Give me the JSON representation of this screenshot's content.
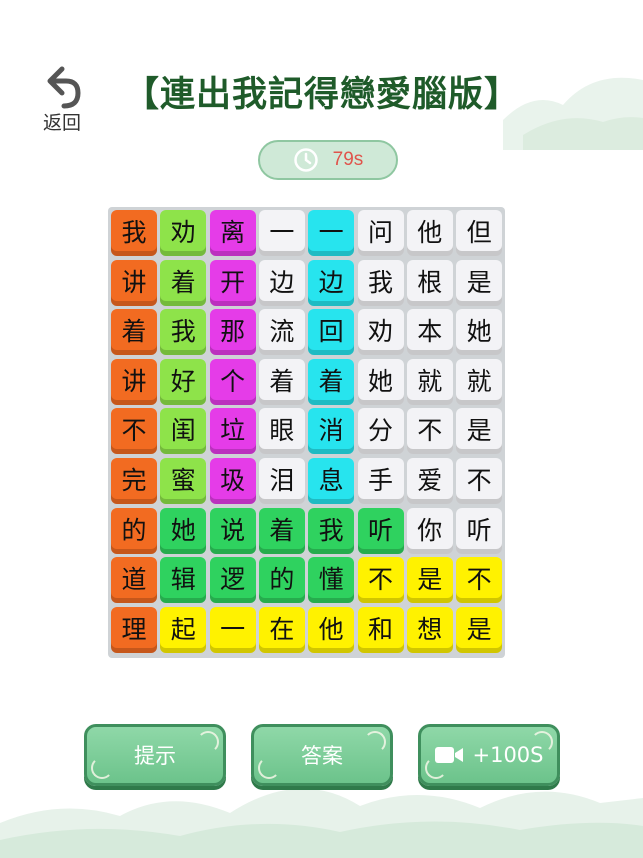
{
  "header": {
    "back_label": "返回",
    "title": "【連出我記得戀愛腦版】"
  },
  "timer": {
    "text": "79s"
  },
  "board": {
    "rows": [
      [
        [
          "我",
          "orange"
        ],
        [
          "劝",
          "lime"
        ],
        [
          "离",
          "magenta"
        ],
        [
          "一",
          "white"
        ],
        [
          "一",
          "cyan"
        ],
        [
          "问",
          "white"
        ],
        [
          "他",
          "white"
        ],
        [
          "但",
          "white"
        ]
      ],
      [
        [
          "讲",
          "orange"
        ],
        [
          "着",
          "lime"
        ],
        [
          "开",
          "magenta"
        ],
        [
          "边",
          "white"
        ],
        [
          "边",
          "cyan"
        ],
        [
          "我",
          "white"
        ],
        [
          "根",
          "white"
        ],
        [
          "是",
          "white"
        ]
      ],
      [
        [
          "着",
          "orange"
        ],
        [
          "我",
          "lime"
        ],
        [
          "那",
          "magenta"
        ],
        [
          "流",
          "white"
        ],
        [
          "回",
          "cyan"
        ],
        [
          "劝",
          "white"
        ],
        [
          "本",
          "white"
        ],
        [
          "她",
          "white"
        ]
      ],
      [
        [
          "讲",
          "orange"
        ],
        [
          "好",
          "lime"
        ],
        [
          "个",
          "magenta"
        ],
        [
          "着",
          "white"
        ],
        [
          "着",
          "cyan"
        ],
        [
          "她",
          "white"
        ],
        [
          "就",
          "white"
        ],
        [
          "就",
          "white"
        ]
      ],
      [
        [
          "不",
          "orange"
        ],
        [
          "闺",
          "lime"
        ],
        [
          "垃",
          "magenta"
        ],
        [
          "眼",
          "white"
        ],
        [
          "消",
          "cyan"
        ],
        [
          "分",
          "white"
        ],
        [
          "不",
          "white"
        ],
        [
          "是",
          "white"
        ]
      ],
      [
        [
          "完",
          "orange"
        ],
        [
          "蜜",
          "lime"
        ],
        [
          "圾",
          "magenta"
        ],
        [
          "泪",
          "white"
        ],
        [
          "息",
          "cyan"
        ],
        [
          "手",
          "white"
        ],
        [
          "爱",
          "white"
        ],
        [
          "不",
          "white"
        ]
      ],
      [
        [
          "的",
          "orange"
        ],
        [
          "她",
          "green"
        ],
        [
          "说",
          "green"
        ],
        [
          "着",
          "green"
        ],
        [
          "我",
          "green"
        ],
        [
          "听",
          "green"
        ],
        [
          "你",
          "white"
        ],
        [
          "听",
          "white"
        ]
      ],
      [
        [
          "道",
          "orange"
        ],
        [
          "辑",
          "green"
        ],
        [
          "逻",
          "green"
        ],
        [
          "的",
          "green"
        ],
        [
          "懂",
          "green"
        ],
        [
          "不",
          "yellow"
        ],
        [
          "是",
          "yellow"
        ],
        [
          "不",
          "yellow"
        ]
      ],
      [
        [
          "理",
          "orange"
        ],
        [
          "起",
          "yellow"
        ],
        [
          "一",
          "yellow"
        ],
        [
          "在",
          "yellow"
        ],
        [
          "他",
          "yellow"
        ],
        [
          "和",
          "yellow"
        ],
        [
          "想",
          "yellow"
        ],
        [
          "是",
          "yellow"
        ]
      ]
    ]
  },
  "colors": {
    "orange": "#f26b21",
    "lime": "#8ee34a",
    "magenta": "#e53ce8",
    "cyan": "#27e4ee",
    "green": "#2fd25f",
    "yellow": "#fff200",
    "white": "#f3f3f6"
  },
  "buttons": {
    "hint": "提示",
    "answer": "答案",
    "video": "+100S"
  }
}
